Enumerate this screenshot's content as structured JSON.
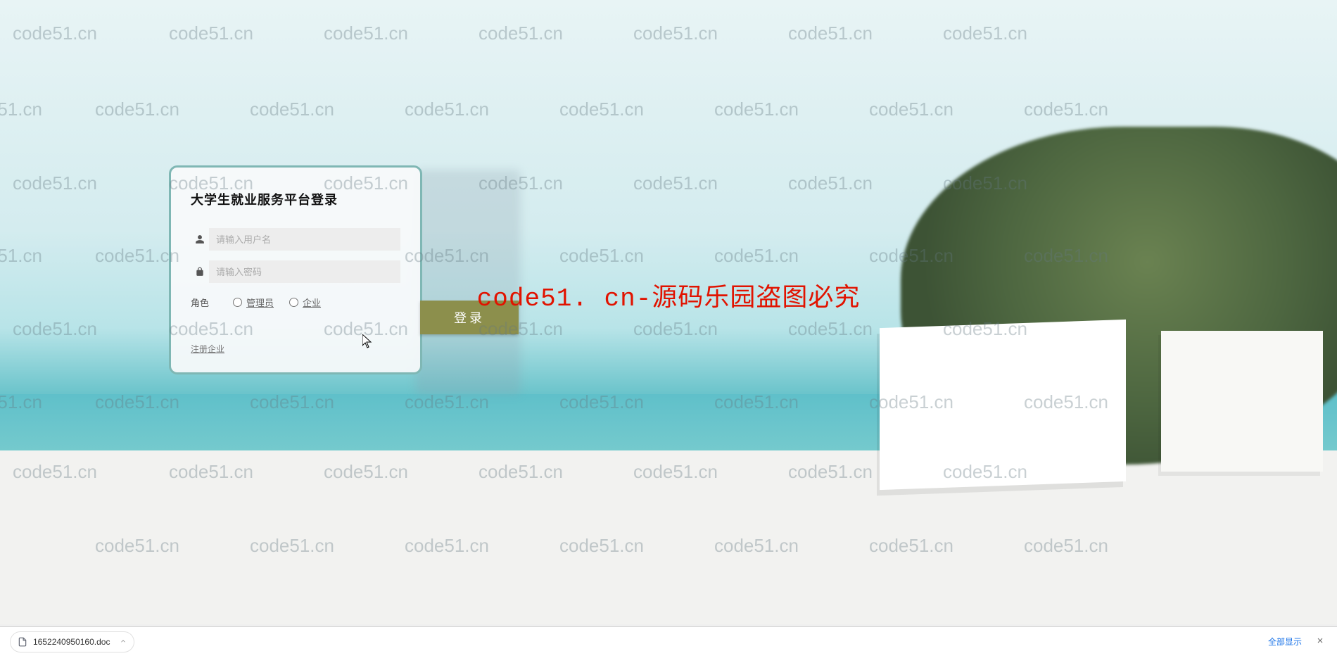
{
  "watermark_text": "code51.cn",
  "watermark_center": "code51. cn-源码乐园盗图必究",
  "login": {
    "title": "大学生就业服务平台登录",
    "username_placeholder": "请输入用户名",
    "password_placeholder": "请输入密码",
    "role_label": "角色",
    "role_options": [
      "管理员",
      "企业"
    ],
    "login_button": "登录",
    "register_link": "注册企业"
  },
  "download_bar": {
    "filename": "1652240950160.doc",
    "show_all": "全部显示"
  },
  "colors": {
    "card_border": "#7fb7b4",
    "login_button": "#8c8f4c",
    "watermark_red": "#e11300"
  }
}
